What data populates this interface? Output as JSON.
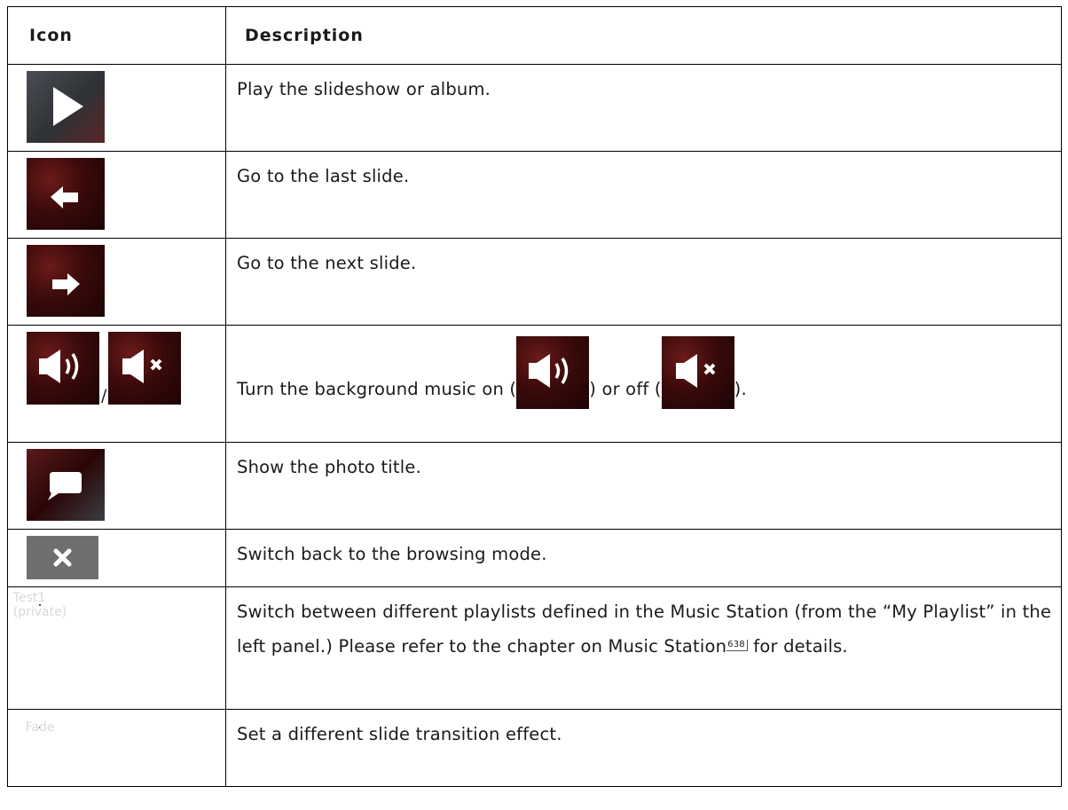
{
  "header": {
    "icon": "Icon",
    "description": "Description"
  },
  "rows": [
    {
      "icon": "play-icon",
      "description": "Play the slideshow or album."
    },
    {
      "icon": "previous-slide-icon",
      "description": "Go to the last slide."
    },
    {
      "icon": "next-slide-icon",
      "description": "Go to the next slide."
    },
    {
      "icon": "music-on-icon / music-off-icon",
      "slash": "/",
      "description_parts": [
        "Turn the background music on (",
        ") or off (",
        ")."
      ]
    },
    {
      "icon": "speech-bubble-icon",
      "description": "Show the photo title."
    },
    {
      "icon": "close-icon",
      "description": "Switch back to the browsing mode."
    },
    {
      "icon_label": "Test1 (private)",
      "description_parts": [
        "Switch between different playlists defined in the Music Station (from the “My Playlist” in the left panel.) Please refer to the chapter on Music Station",
        "638",
        " for details."
      ]
    },
    {
      "icon_label": "Fade",
      "description": "Set a different slide transition effect."
    }
  ],
  "colors": {
    "icon_dark_red": "#3a0a0a",
    "close_box": "#6f6f6f",
    "border": "#000000"
  }
}
